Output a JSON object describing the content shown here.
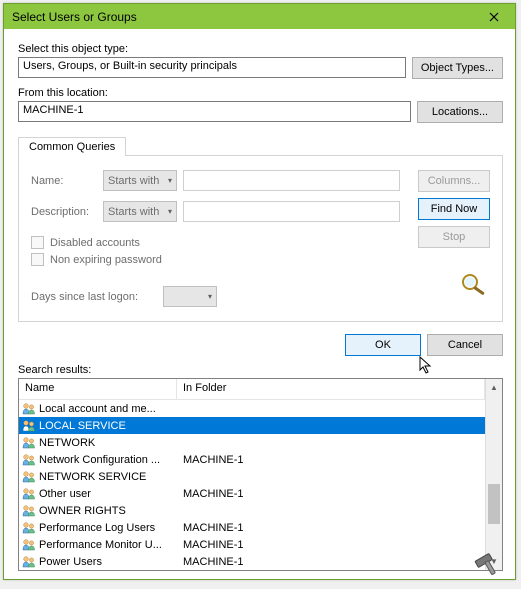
{
  "title": "Select Users or Groups",
  "labels": {
    "objectType": "Select this object type:",
    "location": "From this location:",
    "searchResults": "Search results:"
  },
  "objectType": "Users, Groups, or Built-in security principals",
  "location": "MACHINE-1",
  "buttons": {
    "objectTypes": "Object Types...",
    "locations": "Locations...",
    "columns": "Columns...",
    "findNow": "Find Now",
    "stop": "Stop",
    "ok": "OK",
    "cancel": "Cancel"
  },
  "tab": {
    "commonQueries": "Common Queries"
  },
  "queries": {
    "nameLabel": "Name:",
    "descLabel": "Description:",
    "startsWith": "Starts with",
    "disabledAccounts": "Disabled accounts",
    "nonExpiring": "Non expiring password",
    "daysSince": "Days since last logon:"
  },
  "columns": {
    "name": "Name",
    "inFolder": "In Folder"
  },
  "results": [
    {
      "name": "Local account and me...",
      "folder": "",
      "selected": false,
      "type": "group"
    },
    {
      "name": "LOCAL SERVICE",
      "folder": "",
      "selected": true,
      "type": "group"
    },
    {
      "name": "NETWORK",
      "folder": "",
      "selected": false,
      "type": "group"
    },
    {
      "name": "Network Configuration ...",
      "folder": "MACHINE-1",
      "selected": false,
      "type": "group"
    },
    {
      "name": "NETWORK SERVICE",
      "folder": "",
      "selected": false,
      "type": "group"
    },
    {
      "name": "Other user",
      "folder": "MACHINE-1",
      "selected": false,
      "type": "user"
    },
    {
      "name": "OWNER RIGHTS",
      "folder": "",
      "selected": false,
      "type": "group"
    },
    {
      "name": "Performance Log Users",
      "folder": "MACHINE-1",
      "selected": false,
      "type": "group"
    },
    {
      "name": "Performance Monitor U...",
      "folder": "MACHINE-1",
      "selected": false,
      "type": "group"
    },
    {
      "name": "Power Users",
      "folder": "MACHINE-1",
      "selected": false,
      "type": "group"
    }
  ]
}
